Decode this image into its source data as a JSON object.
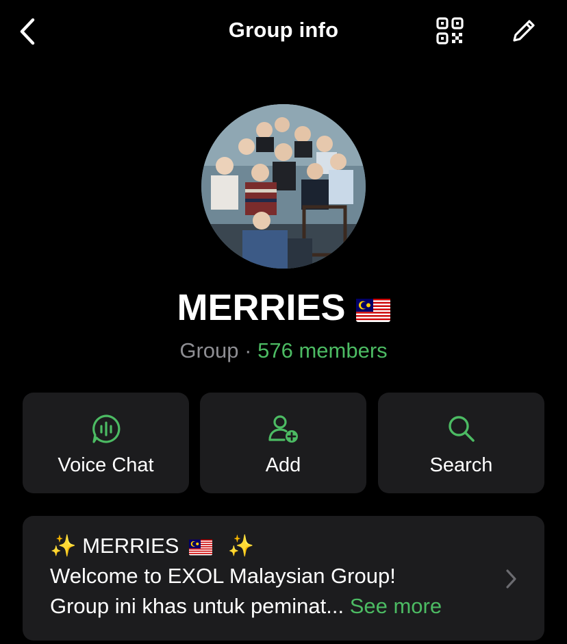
{
  "header": {
    "title": "Group info",
    "back_icon": "chevron-left-icon",
    "qr_icon": "qr-code-icon",
    "edit_icon": "pencil-icon"
  },
  "group": {
    "name": "MERRIES",
    "flag_icon": "malaysia-flag-icon",
    "type": "Group",
    "separator": "·",
    "members": "576 members"
  },
  "actions": [
    {
      "label": "Voice Chat",
      "icon": "voice-chat-icon"
    },
    {
      "label": "Add",
      "icon": "add-member-icon"
    },
    {
      "label": "Search",
      "icon": "search-icon"
    }
  ],
  "about": {
    "title_prefix": "✨ MERRIES",
    "title_suffix": "✨",
    "line1": "Welcome to EXOL Malaysian Group!",
    "line2": "Group ini khas untuk peminat...",
    "see_more": "See more"
  },
  "colors": {
    "background": "#000000",
    "card": "#1c1c1e",
    "accent_green": "#4cbb63",
    "muted_text": "#8e8e93",
    "text": "#ffffff"
  }
}
